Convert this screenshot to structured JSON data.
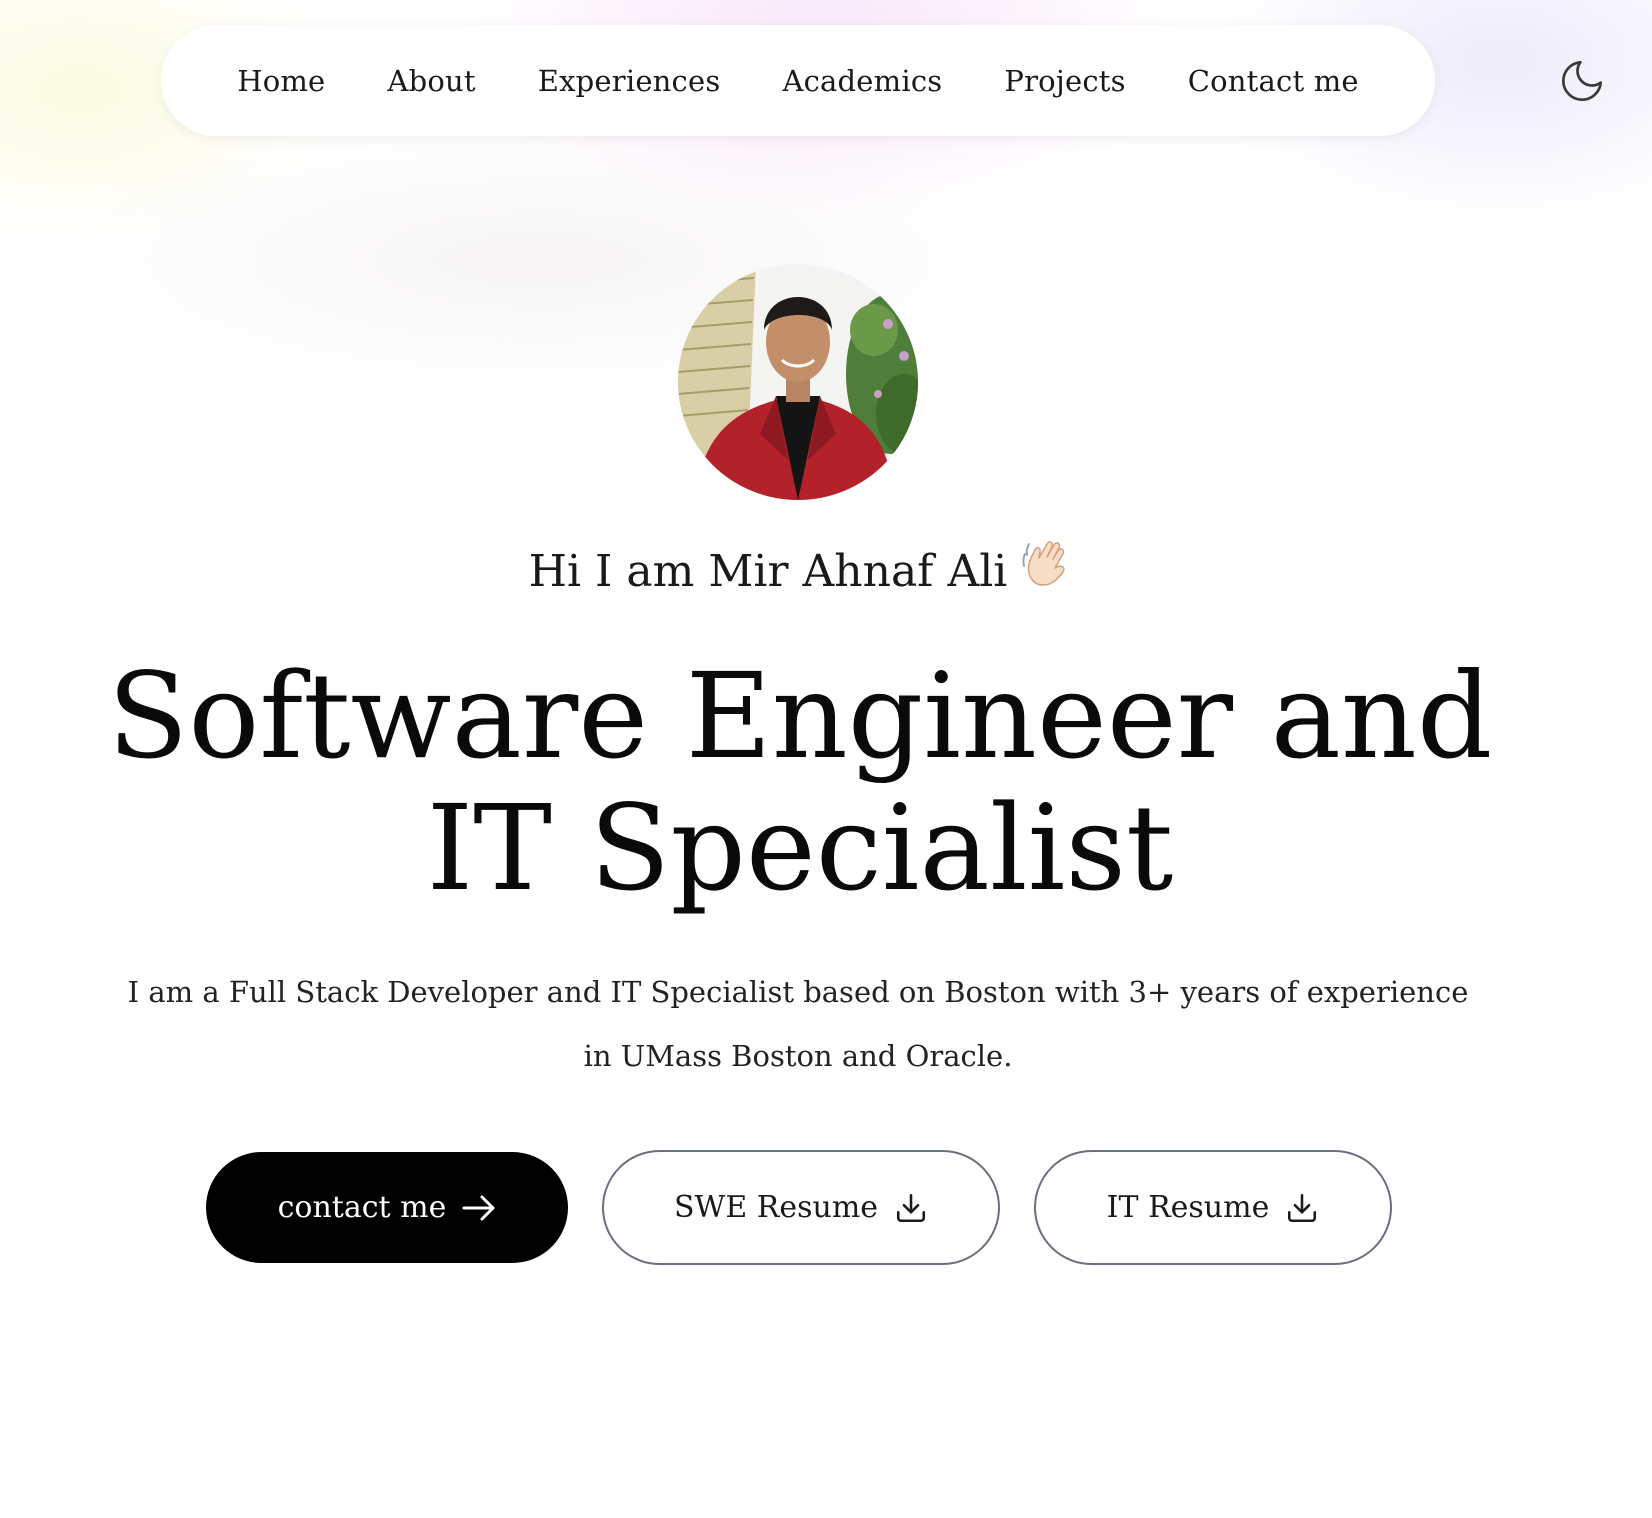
{
  "nav": {
    "items": [
      {
        "label": "Home"
      },
      {
        "label": "About"
      },
      {
        "label": "Experiences"
      },
      {
        "label": "Academics"
      },
      {
        "label": "Projects"
      },
      {
        "label": "Contact me"
      }
    ],
    "theme_icon": "moon-icon"
  },
  "hero": {
    "avatar_icon": "profile-photo",
    "greeting": "Hi I am Mir Ahnaf Ali",
    "greeting_icon": "waving-hand-emoji",
    "headline": "Software Engineer and IT Specialist",
    "intro": "I am a Full Stack Developer and IT Specialist based on Boston with 3+ years of experience in UMass Boston and Oracle."
  },
  "buttons": {
    "contact": {
      "label": "contact me",
      "icon": "arrow-right-icon"
    },
    "swe_resume": {
      "label": "SWE Resume",
      "icon": "download-icon"
    },
    "it_resume": {
      "label": "IT Resume",
      "icon": "download-icon"
    }
  },
  "colors": {
    "primary_button_bg": "#000000",
    "primary_button_text": "#ffffff",
    "outline_border": "#6b7080",
    "text": "#111111",
    "background": "#ffffff"
  }
}
